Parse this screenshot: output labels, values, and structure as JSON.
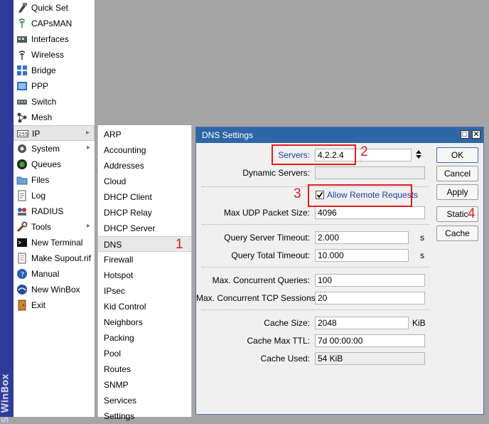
{
  "brand": {
    "text": "S WinBox"
  },
  "menu": {
    "items": [
      {
        "label": "Quick Set",
        "icon": "quick-set-icon"
      },
      {
        "label": "CAPsMAN",
        "icon": "capsman-icon"
      },
      {
        "label": "Interfaces",
        "icon": "interfaces-icon"
      },
      {
        "label": "Wireless",
        "icon": "wireless-icon"
      },
      {
        "label": "Bridge",
        "icon": "bridge-icon"
      },
      {
        "label": "PPP",
        "icon": "ppp-icon"
      },
      {
        "label": "Switch",
        "icon": "switch-icon"
      },
      {
        "label": "Mesh",
        "icon": "mesh-icon"
      },
      {
        "label": "IP",
        "icon": "ip-icon"
      },
      {
        "label": "System",
        "icon": "system-icon"
      },
      {
        "label": "Queues",
        "icon": "queues-icon"
      },
      {
        "label": "Files",
        "icon": "files-icon"
      },
      {
        "label": "Log",
        "icon": "log-icon"
      },
      {
        "label": "RADIUS",
        "icon": "radius-icon"
      },
      {
        "label": "Tools",
        "icon": "tools-icon"
      },
      {
        "label": "New Terminal",
        "icon": "terminal-icon"
      },
      {
        "label": "Make Supout.rif",
        "icon": "supout-icon"
      },
      {
        "label": "Manual",
        "icon": "manual-icon"
      },
      {
        "label": "New WinBox",
        "icon": "winbox-icon"
      },
      {
        "label": "Exit",
        "icon": "exit-icon"
      }
    ]
  },
  "submenu": {
    "items": [
      "ARP",
      "Accounting",
      "Addresses",
      "Cloud",
      "DHCP Client",
      "DHCP Relay",
      "DHCP Server",
      "DNS",
      "Firewall",
      "Hotspot",
      "IPsec",
      "Kid Control",
      "Neighbors",
      "Packing",
      "Pool",
      "Routes",
      "SNMP",
      "Services",
      "Settings"
    ]
  },
  "annotations": {
    "a1": "1",
    "a2": "2",
    "a3": "3",
    "a4": "4"
  },
  "dialog": {
    "title": "DNS Settings",
    "servers_label": "Servers:",
    "servers_value": "4.2.2.4",
    "dynamic_servers_label": "Dynamic Servers:",
    "allow_remote_label": "Allow Remote Requests",
    "allow_remote_checked": true,
    "max_udp_label": "Max UDP Packet Size:",
    "max_udp_value": "4096",
    "query_server_timeout_label": "Query Server Timeout:",
    "query_server_timeout_value": "2.000",
    "query_total_timeout_label": "Query Total Timeout:",
    "query_total_timeout_value": "10.000",
    "seconds_unit": "s",
    "max_concurrent_queries_label": "Max. Concurrent Queries:",
    "max_concurrent_queries_value": "100",
    "max_concurrent_tcp_label": "Max. Concurrent TCP Sessions:",
    "max_concurrent_tcp_value": "20",
    "cache_size_label": "Cache Size:",
    "cache_size_value": "2048",
    "cache_size_unit": "KiB",
    "cache_max_ttl_label": "Cache Max TTL:",
    "cache_max_ttl_value": "7d 00:00:00",
    "cache_used_label": "Cache Used:",
    "cache_used_value": "54 KiB",
    "buttons": {
      "ok": "OK",
      "cancel": "Cancel",
      "apply": "Apply",
      "static": "Static",
      "cache": "Cache"
    }
  },
  "colors": {
    "accent": "#2e67a8",
    "annotation": "#e31d1d",
    "brand": "#2f3b98"
  }
}
